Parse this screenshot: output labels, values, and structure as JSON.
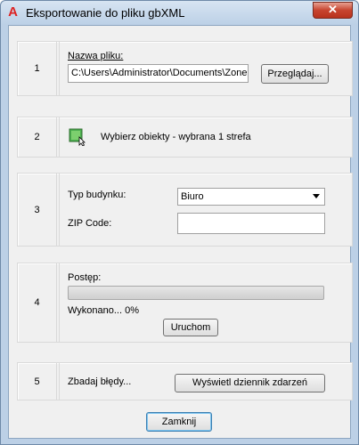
{
  "window": {
    "title": "Eksportowanie do pliku gbXML",
    "close_label": "✕"
  },
  "step1": {
    "number": "1",
    "label": "Nazwa pliku:",
    "path_value": "C:\\Users\\Administrator\\Documents\\Zone",
    "browse_label": "Przeglądaj..."
  },
  "step2": {
    "number": "2",
    "pick_label": "Wybierz obiekty - wybrana 1 strefa"
  },
  "step3": {
    "number": "3",
    "building_type_label": "Typ budynku:",
    "building_type_value": "Biuro",
    "zip_label": "ZIP Code:",
    "zip_value": ""
  },
  "step4": {
    "number": "4",
    "progress_label": "Postęp:",
    "progress_percent": 0,
    "done_text": "Wykonano... 0%",
    "run_label": "Uruchom"
  },
  "step5": {
    "number": "5",
    "errors_label": "Zbadaj błędy...",
    "log_label": "Wyświetl dziennik zdarzeń"
  },
  "footer": {
    "close_label": "Zamknij"
  }
}
